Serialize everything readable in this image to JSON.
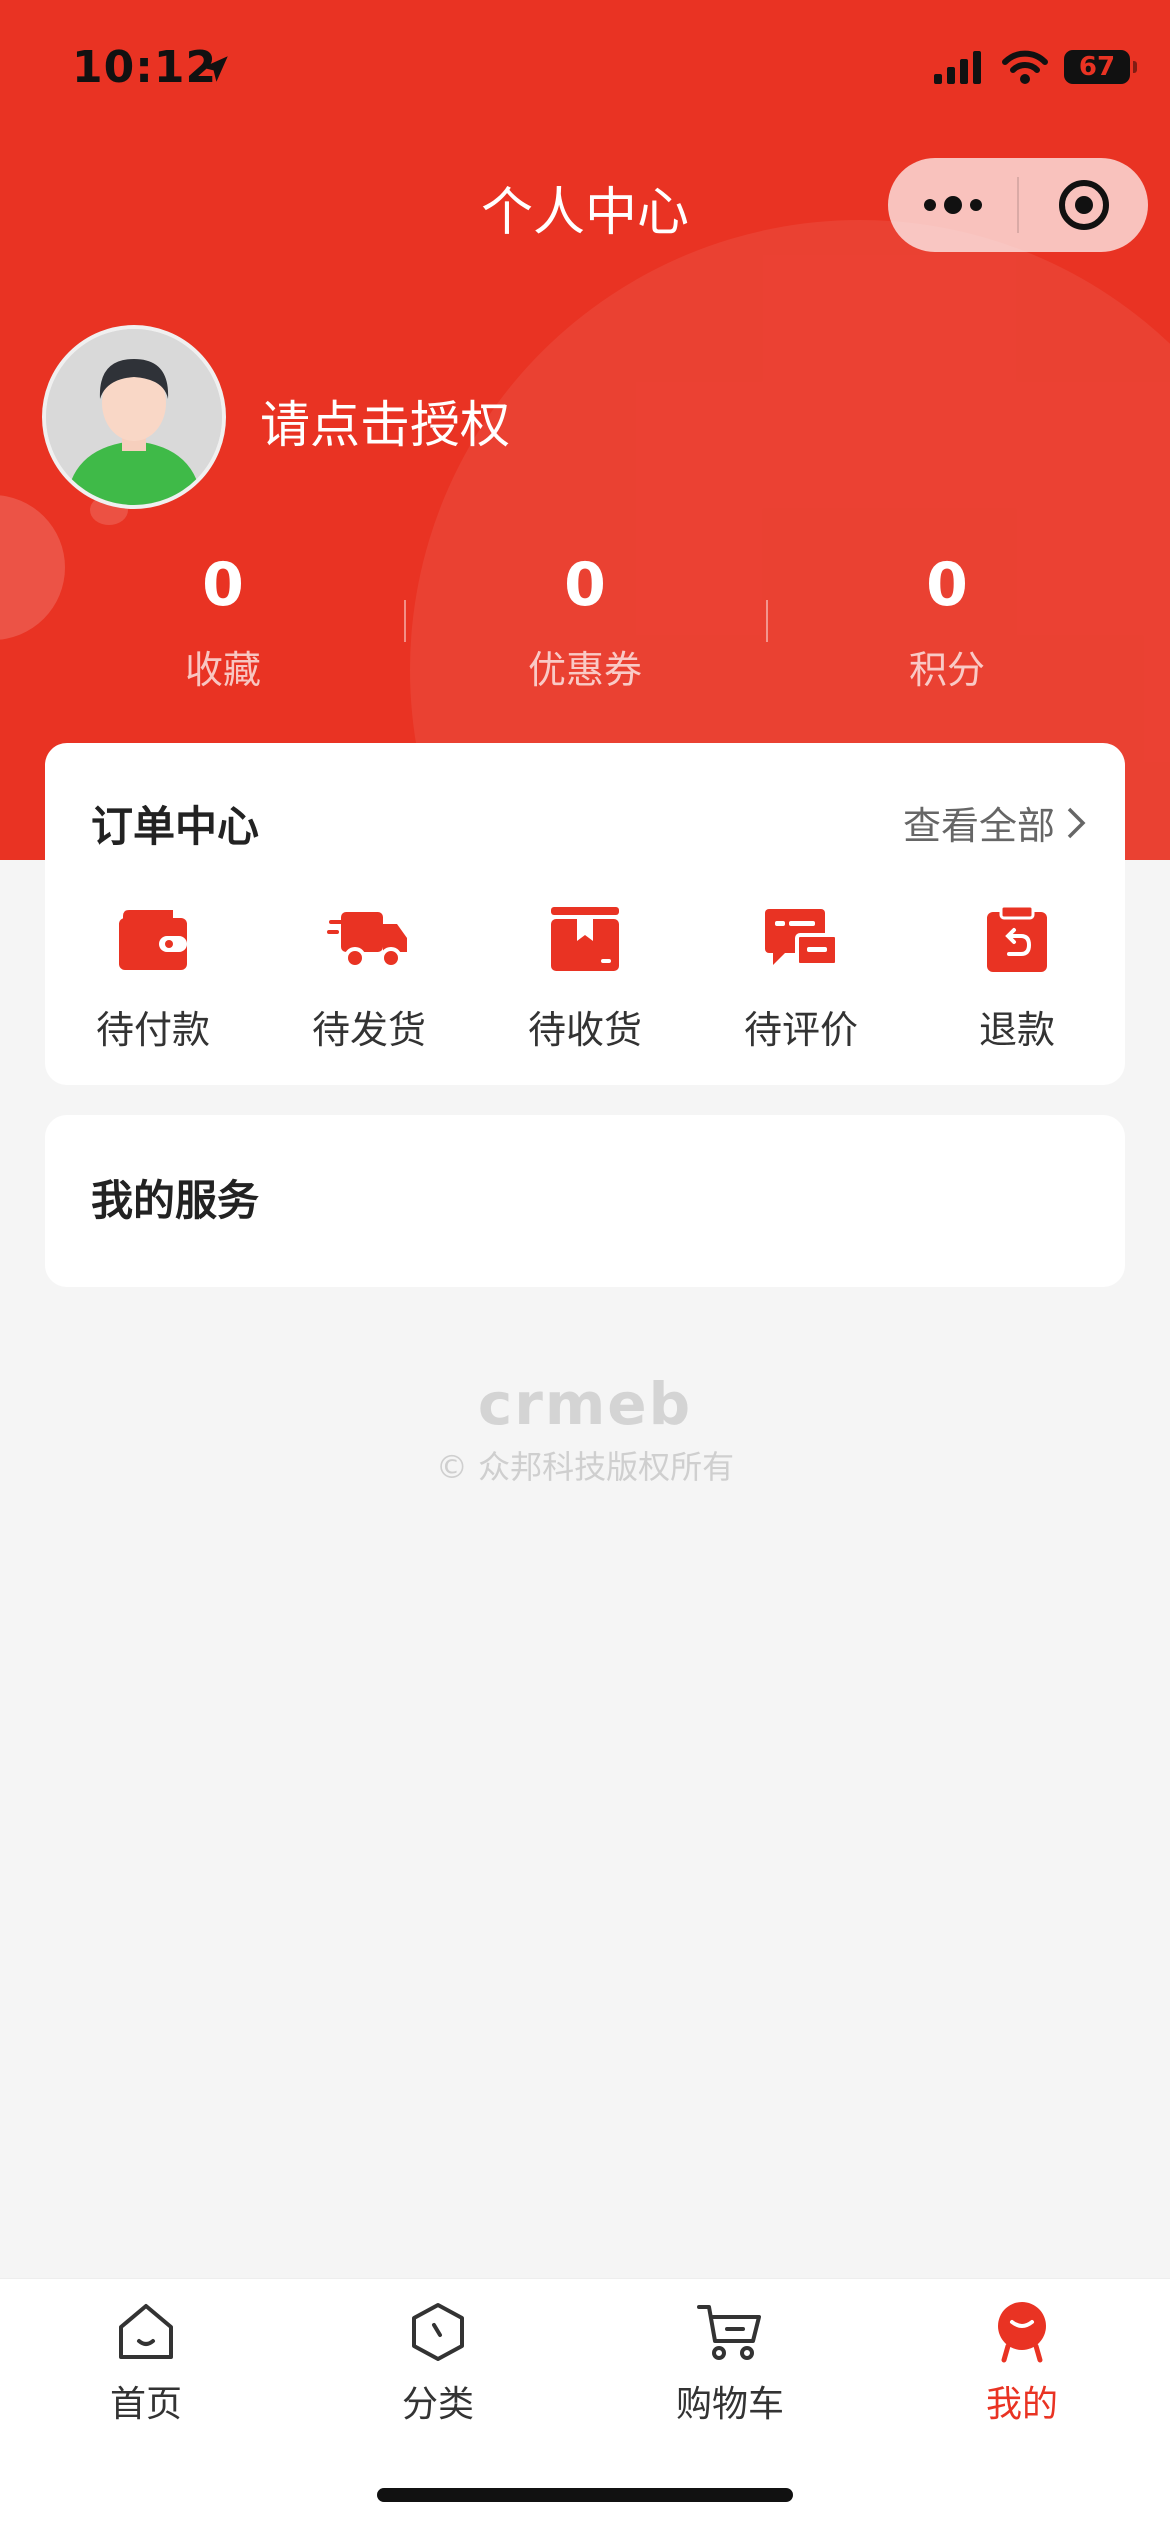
{
  "status_bar": {
    "time": "10:12",
    "battery": "67"
  },
  "nav": {
    "title": "个人中心"
  },
  "user": {
    "name": "请点击授权"
  },
  "stats": [
    {
      "value": "0",
      "label": "收藏"
    },
    {
      "value": "0",
      "label": "优惠券"
    },
    {
      "value": "0",
      "label": "积分"
    }
  ],
  "order_center": {
    "title": "订单中心",
    "view_all": "查看全部",
    "items": [
      {
        "label": "待付款",
        "icon": "wallet-icon"
      },
      {
        "label": "待发货",
        "icon": "truck-icon"
      },
      {
        "label": "待收货",
        "icon": "box-icon"
      },
      {
        "label": "待评价",
        "icon": "comment-icon"
      },
      {
        "label": "退款",
        "icon": "refund-icon"
      }
    ]
  },
  "services": {
    "title": "我的服务"
  },
  "footer": {
    "logo": "crmeb",
    "copyright": "© 众邦科技版权所有"
  },
  "tabbar": [
    {
      "label": "首页",
      "icon": "home-icon"
    },
    {
      "label": "分类",
      "icon": "category-icon"
    },
    {
      "label": "购物车",
      "icon": "cart-icon"
    },
    {
      "label": "我的",
      "icon": "profile-icon",
      "active": true
    }
  ],
  "colors": {
    "primary": "#e93323",
    "background": "#f5f5f5"
  }
}
